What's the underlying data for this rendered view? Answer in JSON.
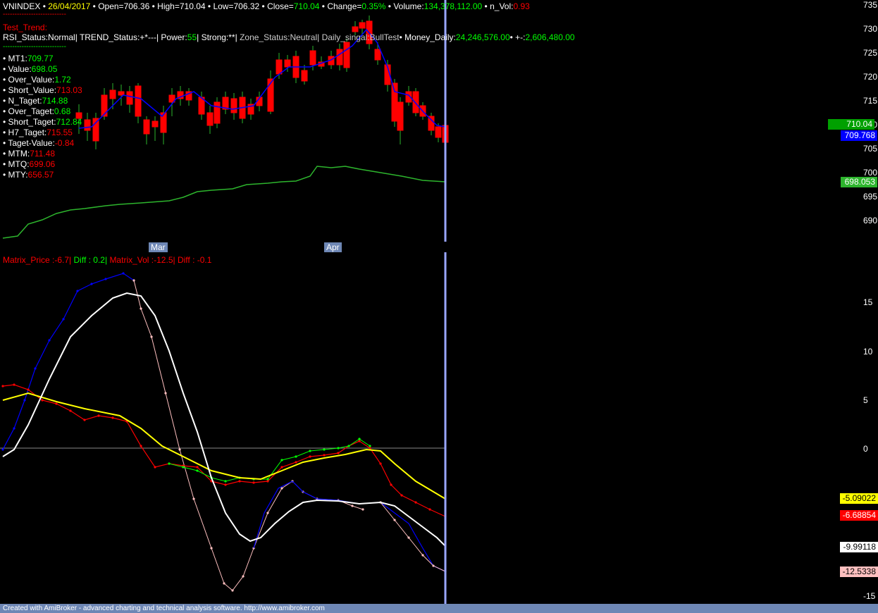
{
  "header": {
    "symbol": "VNINDEX",
    "date": "26/04/2017",
    "open_label": "Open=",
    "open": "706.36",
    "high_label": "High=",
    "high": "710.04",
    "low_label": "Low=",
    "low": "706.32",
    "close_label": "Close=",
    "close": "710.04",
    "change_label": "Change=",
    "change": "0.35%",
    "volume_label": "Volume:",
    "volume": "134,378,112.00",
    "nvol_label": "n_Vol:",
    "nvol": "0.93"
  },
  "dashes": "---------------------------",
  "test_trend": "Test_Trend:",
  "status_line": {
    "rsi": "RSI_Status:Normal| TREND_Status:+*---| Power:",
    "power": "55",
    "strong": "| Strong:**| ",
    "zone": "Zone_Status:Neutral| Daily_singal:BullTest",
    "money_label": "• Money_Daily:",
    "money": "24,246,576.00",
    "pm_label": "• +-:",
    "pm": "2,606,480.00"
  },
  "metrics": [
    {
      "label": "• MT1:",
      "value": "709.77",
      "color": "#00ff00"
    },
    {
      "label": "• Value:",
      "value": "698.05",
      "color": "#00ff00"
    },
    {
      "label": "• Over_Value:",
      "value": "1.72",
      "color": "#00ff00"
    },
    {
      "label": "• Short_Value:",
      "value": "713.03",
      "color": "#ff0000"
    },
    {
      "label": "• N_Taget:",
      "value": "714.88",
      "color": "#00ff00"
    },
    {
      "label": "• Over_Taget:",
      "value": "0.68",
      "color": "#00ff00"
    },
    {
      "label": "• Short_Taget:",
      "value": "712.84",
      "color": "#00ff00"
    },
    {
      "label": "• H7_Taget:",
      "value": "715.55",
      "color": "#ff0000"
    },
    {
      "label": "• Taget-Value:",
      "value": "-0.84",
      "color": "#ff0000"
    },
    {
      "label": "• MTM:",
      "value": "711.48",
      "color": "#ff0000"
    },
    {
      "label": "• MTQ:",
      "value": "699.06",
      "color": "#ff0000"
    },
    {
      "label": "• MTY:",
      "value": "656.57",
      "color": "#ff0000"
    }
  ],
  "price_axis": [
    "735",
    "730",
    "725",
    "720",
    "715",
    "710",
    "705",
    "700",
    "695",
    "690"
  ],
  "price_tags": {
    "close": "710.04",
    "mt1": "709.768",
    "value": "698.053"
  },
  "months": {
    "mar": "Mar",
    "apr": "Apr"
  },
  "matrix_header": {
    "price_label": "Matrix_Price :",
    "price": "-6.7|",
    "diff1": "Diff : 0.2|",
    "vol_label": "Matrix_Vol :",
    "vol": "-12.5|",
    "diff2": "Diff : -0.1"
  },
  "osc_axis": [
    "15",
    "10",
    "5",
    "0",
    "-15"
  ],
  "osc_tags": {
    "yellow": "-5.09022",
    "red": "-6.68854",
    "white": "-9.99118",
    "pink": "-12.5338"
  },
  "colors": {
    "up": "#ffffff",
    "down": "#ff0000",
    "ma": "#0000ff",
    "value_line": "#2db52d",
    "cursor": "#9aa6ff",
    "axis_bg": "#6e87b5"
  },
  "footer": "Created with AmiBroker - advanced charting and technical analysis software. http://www.amibroker.com"
}
